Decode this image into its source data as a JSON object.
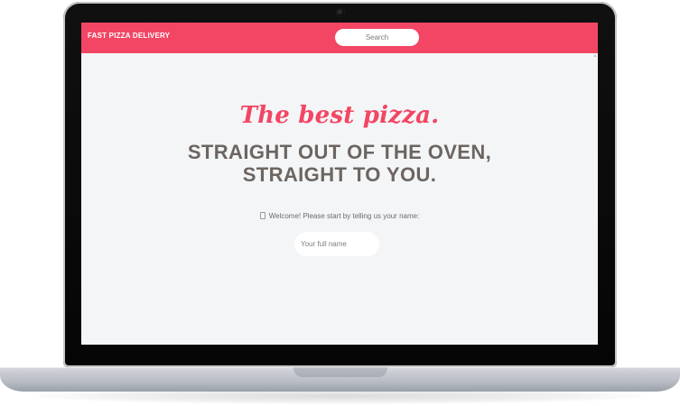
{
  "app": {
    "brand": "FAST PIZZA DELIVERY",
    "search_label": "Search",
    "hero": {
      "script_title": "The best pizza.",
      "headline_line_1": "STRAIGHT OUT OF THE OVEN,",
      "headline_line_2": "STRAIGHT TO YOU."
    },
    "welcome_prompt": "Welcome! Please start by telling us your name:",
    "name_input": {
      "placeholder": "Your full name",
      "value": ""
    }
  },
  "colors": {
    "accent": "#f24664",
    "background": "#f4f5f7",
    "heading": "#6c6561",
    "text_muted": "#6b6b6b"
  },
  "icons": {
    "prompt_icon": "pizza-icon"
  }
}
